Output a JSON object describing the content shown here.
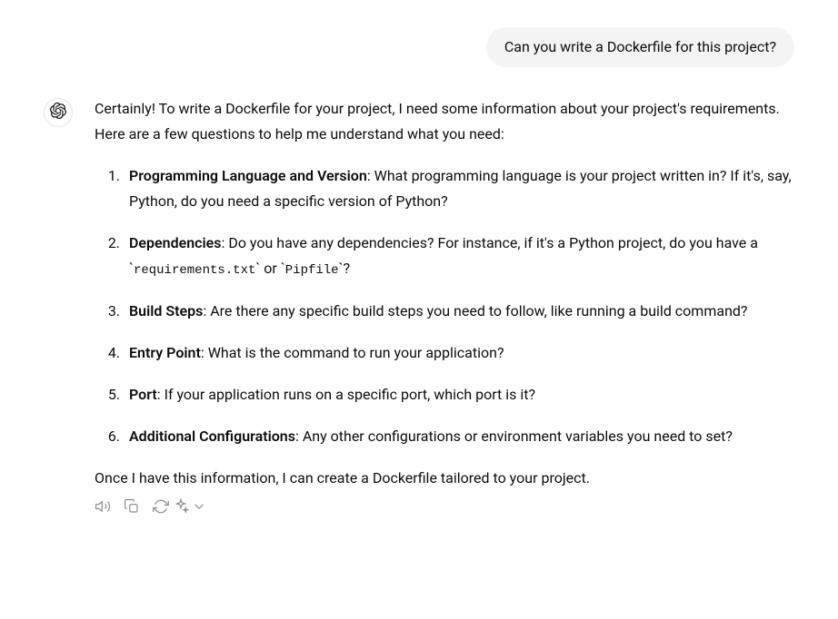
{
  "user_message": "Can you write a  Dockerfile for this project?",
  "assistant": {
    "intro": "Certainly! To write a Dockerfile for your project, I need some information about your project's requirements. Here are a few questions to help me understand what you need:",
    "items": [
      {
        "title": "Programming Language and Version",
        "body": ": What programming language is your project written in? If it's, say, Python, do you need a specific version of Python?"
      },
      {
        "title": "Dependencies",
        "body_prefix": ": Do you have any dependencies? For instance, if it's a Python project, do you have a ",
        "code1": "requirements.txt",
        "mid": " or ",
        "code2": "Pipfile",
        "suffix": "?"
      },
      {
        "title": "Build Steps",
        "body": ": Are there any specific build steps you need to follow, like running a build command?"
      },
      {
        "title": "Entry Point",
        "body": ": What is the command to run your application?"
      },
      {
        "title": "Port",
        "body": ": If your application runs on a specific port, which port is it?"
      },
      {
        "title": "Additional Configurations",
        "body": ": Any other configurations or environment variables you need to set?"
      }
    ],
    "closing": "Once I have this information, I can create a Dockerfile tailored to your project."
  }
}
